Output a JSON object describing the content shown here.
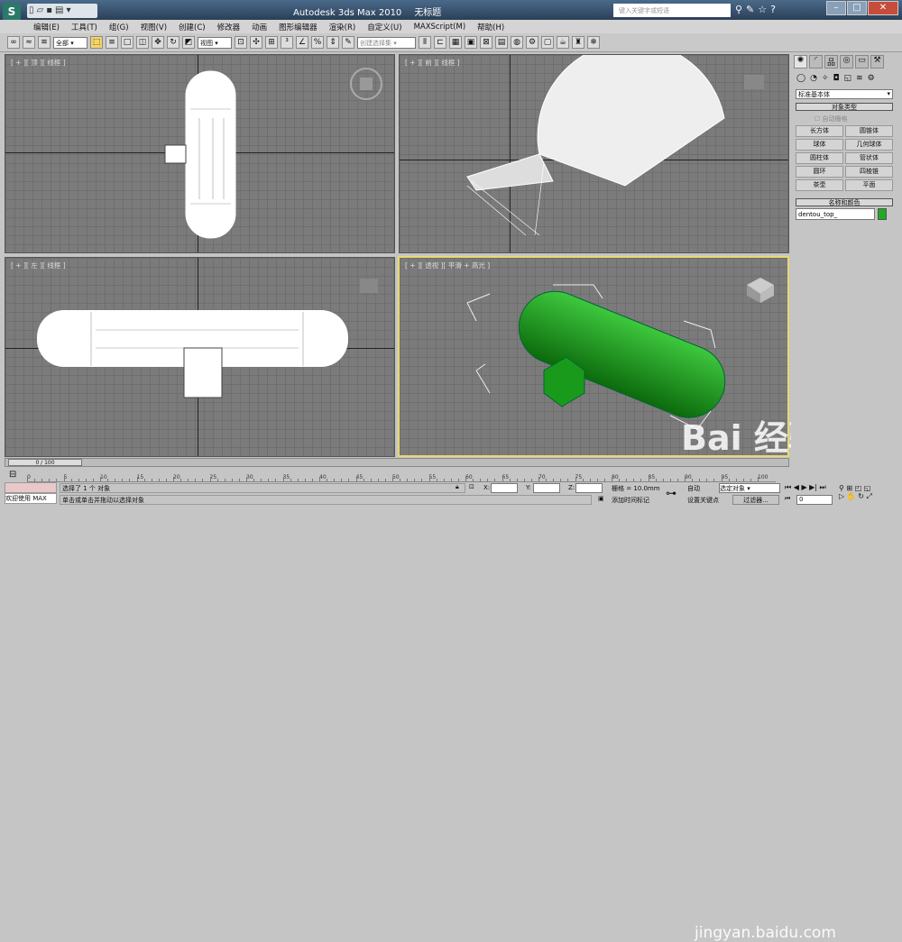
{
  "title": {
    "app": "Autodesk 3ds Max  2010",
    "doc": "无标题",
    "search_placeholder": "键入关键字或短语"
  },
  "menu": [
    "编辑(E)",
    "工具(T)",
    "组(G)",
    "视图(V)",
    "创建(C)",
    "修改器",
    "动画",
    "图形编辑器",
    "渲染(R)",
    "自定义(U)",
    "MAXScript(M)",
    "帮助(H)"
  ],
  "toolbar": {
    "filter": "全部",
    "coord": "视图",
    "selset": "创建选择集"
  },
  "viewports": {
    "top": "[ + ][ 顶 ][ 线框 ]",
    "front": "[ + ][ 前 ][ 线框 ]",
    "left": "[ + ][ 左 ][ 线框 ]",
    "persp": "[ + ][ 透视 ][ 平滑 + 高光 ]"
  },
  "panel": {
    "category": "标准基本体",
    "object_type": "对象类型",
    "autogrid": "自动栅格",
    "buttons": [
      "长方体",
      "圆锥体",
      "球体",
      "几何球体",
      "圆柱体",
      "管状体",
      "圆环",
      "四棱锥",
      "茶壶",
      "平面"
    ],
    "name_color": "名称和颜色",
    "object_name": "dentou_top_",
    "object_color": "#22aa22"
  },
  "timeline": {
    "frame": "0 / 100",
    "ticks": [
      "0",
      "5",
      "10",
      "15",
      "20",
      "25",
      "30",
      "35",
      "40",
      "45",
      "50",
      "55",
      "60",
      "65",
      "70",
      "75",
      "80",
      "85",
      "90",
      "95",
      "100"
    ]
  },
  "status": {
    "welcome": "欢迎使用 MAX",
    "selected": "选择了 1 个 对象",
    "prompt": "单击或单击并拖动以选择对象",
    "x_label": "X:",
    "y_label": "Y:",
    "z_label": "Z:",
    "grid": "栅格 = 10.0mm",
    "add_time_tag": "添加时间标记",
    "autokey": "自动",
    "set_key": "设置关键点",
    "key_filter": "过滤器...",
    "selected_obj": "选定对象",
    "current_frame": "0"
  },
  "watermark": {
    "logo": "Bai 经验",
    "url": "jingyan.baidu.com"
  }
}
